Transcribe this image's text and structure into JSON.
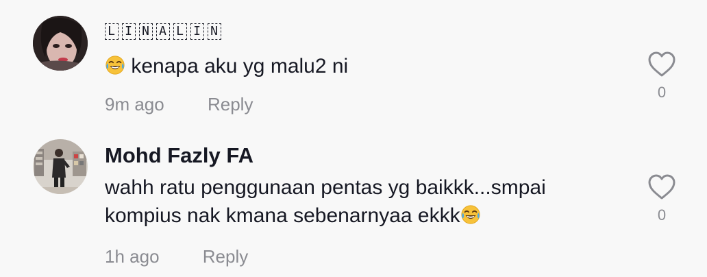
{
  "comments": [
    {
      "username_chars": [
        "L",
        "I",
        "N",
        "A",
        "L",
        "I",
        "N"
      ],
      "emoji": "face-with-tears-of-joy",
      "text": "kenapa aku yg malu2 ni",
      "time": "9m ago",
      "reply_label": "Reply",
      "like_count": "0",
      "like_icon": "heart-outline-icon"
    },
    {
      "username": "Mohd Fazly FA",
      "text": "wahh ratu penggunaan pentas yg baikkk...smpai kompius nak kmana sebenarnyaa ekkk",
      "emoji": "face-with-tears-of-joy",
      "time": "1h ago",
      "reply_label": "Reply",
      "like_count": "0",
      "like_icon": "heart-outline-icon"
    }
  ],
  "colors": {
    "background": "#f8f8f8",
    "text_primary": "#161823",
    "text_secondary": "#8a8b91"
  }
}
